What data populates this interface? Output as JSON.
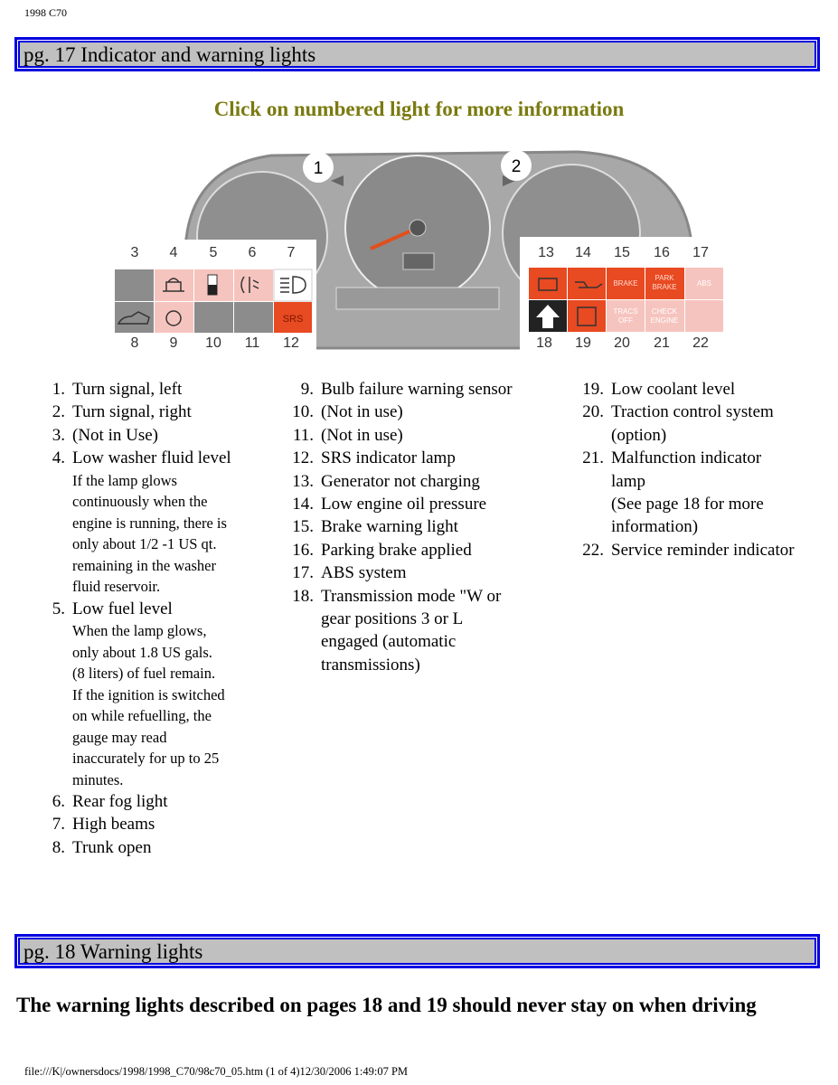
{
  "doc_title": "1998 C70",
  "section1": {
    "title": "pg. 17 Indicator and warning lights"
  },
  "instruction": "Click on numbered light for more information",
  "figure": {
    "callouts": [
      "1",
      "2"
    ],
    "left_panel": {
      "top_numbers": [
        "3",
        "4",
        "5",
        "6",
        "7"
      ],
      "bottom_numbers": [
        "8",
        "9",
        "10",
        "11",
        "12"
      ],
      "srs_label": "SRS"
    },
    "right_panel": {
      "top_numbers": [
        "13",
        "14",
        "15",
        "16",
        "17"
      ],
      "bottom_numbers": [
        "18",
        "19",
        "20",
        "21",
        "22"
      ],
      "labels": {
        "brake": "BRAKE",
        "park1": "PARK",
        "park2": "BRAKE",
        "abs": "ABS",
        "tracs1": "TRACS",
        "tracs2": "OFF",
        "check1": "CHECK",
        "check2": "ENGINE"
      }
    },
    "colors": {
      "red": "#e84a22",
      "pink": "#f6c4be",
      "gray": "#8c8c8c",
      "cluster": "#9a9a9a"
    }
  },
  "list_col1": [
    {
      "n": "1.",
      "t": "Turn signal, left"
    },
    {
      "n": "2.",
      "t": "Turn signal, right"
    },
    {
      "n": "3.",
      "t": "(Not in Use)"
    },
    {
      "n": "4.",
      "t": "Low washer fluid level",
      "sub": [
        "If the lamp glows",
        "continuously when the",
        "engine is running, there is",
        "only about 1/2 -1 US qt.",
        "remaining in the washer",
        "fluid reservoir."
      ]
    },
    {
      "n": "5.",
      "t": "Low fuel level",
      "sub": [
        "When the lamp glows,",
        "only about 1.8 US gals.",
        "(8 liters) of fuel remain.",
        "If the ignition is switched",
        "on while refuelling, the",
        "gauge may read",
        "inaccurately for up to 25",
        "minutes."
      ]
    },
    {
      "n": "6.",
      "t": "Rear fog light"
    },
    {
      "n": "7.",
      "t": "High beams"
    },
    {
      "n": "8.",
      "t": "Trunk open"
    }
  ],
  "list_col2": [
    {
      "n": "9.",
      "t": [
        "Bulb failure warning sensor"
      ]
    },
    {
      "n": "10.",
      "t": [
        "(Not in use)"
      ]
    },
    {
      "n": "11.",
      "t": [
        "(Not in use)"
      ]
    },
    {
      "n": "12.",
      "t": [
        "SRS indicator lamp"
      ]
    },
    {
      "n": "13.",
      "t": [
        "Generator not charging"
      ]
    },
    {
      "n": "14.",
      "t": [
        "Low engine oil pressure"
      ]
    },
    {
      "n": "15.",
      "t": [
        "Brake warning light"
      ]
    },
    {
      "n": "16.",
      "t": [
        "Parking brake applied"
      ]
    },
    {
      "n": "17.",
      "t": [
        "ABS system"
      ]
    },
    {
      "n": "18.",
      "t": [
        "Transmission mode \"W or",
        "gear positions 3 or L",
        "engaged (automatic",
        "transmissions)"
      ]
    }
  ],
  "list_col3": [
    {
      "n": "19.",
      "t": [
        "Low coolant level"
      ]
    },
    {
      "n": "20.",
      "t": [
        "Traction control system",
        "(option)"
      ]
    },
    {
      "n": "21.",
      "t": [
        "Malfunction indicator",
        "lamp",
        "(See page 18 for more",
        "information)"
      ]
    },
    {
      "n": "22.",
      "t": [
        "Service reminder indicator"
      ]
    }
  ],
  "section2": {
    "title": "pg. 18 Warning lights"
  },
  "warning_text": "The warning lights described on pages 18 and 19 should never stay on when driving",
  "footer": "file:///K|/ownersdocs/1998/1998_C70/98c70_05.htm (1 of 4)12/30/2006 1:49:07 PM"
}
